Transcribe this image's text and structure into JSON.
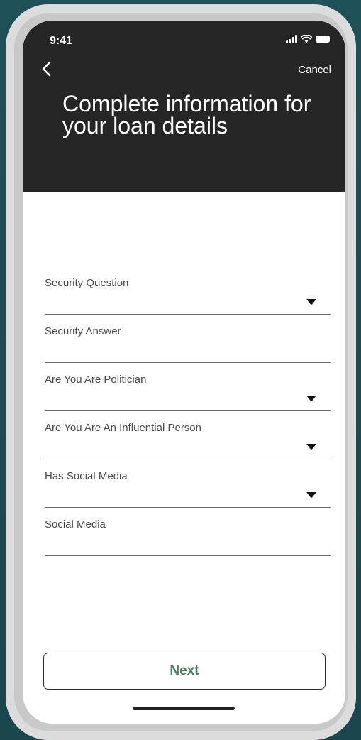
{
  "status_bar": {
    "time": "9:41"
  },
  "header": {
    "back_icon": "chevron-left-icon",
    "cancel_label": "Cancel",
    "title": "Complete information for your loan details"
  },
  "form": {
    "fields": [
      {
        "label": "Security Question",
        "type": "dropdown",
        "icon": "caret-down-icon"
      },
      {
        "label": "Security Answer",
        "type": "text"
      },
      {
        "label": "Are You Are  Politician",
        "type": "dropdown",
        "icon": "caret-down-icon"
      },
      {
        "label": "Are You Are  An Influential Person",
        "type": "dropdown",
        "icon": "caret-down-icon"
      },
      {
        "label": "Has Social Media",
        "type": "dropdown",
        "icon": "caret-down-icon"
      },
      {
        "label": "Social Media",
        "type": "text"
      }
    ]
  },
  "footer": {
    "next_label": "Next"
  },
  "colors": {
    "background": "#1e4d54",
    "header": "#262626",
    "accent_text": "#4a7d64",
    "frame": "#dcdcdc"
  }
}
